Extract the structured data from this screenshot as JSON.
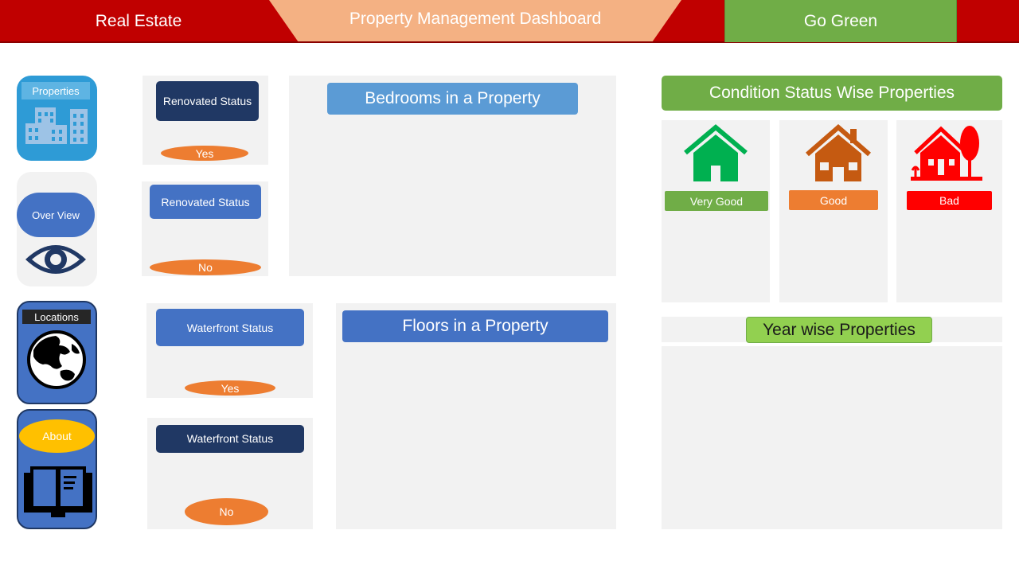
{
  "header": {
    "brand": "Real Estate",
    "title": "Property Management Dashboard",
    "go_green": "Go Green"
  },
  "nav": {
    "properties": "Properties",
    "overview": "Over View",
    "locations": "Locations",
    "about": "About"
  },
  "renovated": {
    "card1_title": "Renovated Status",
    "card1_value": "Yes",
    "card2_title": "Renovated Status",
    "card2_value": "No"
  },
  "waterfront": {
    "card1_title": "Waterfront Status",
    "card1_value": "Yes",
    "card2_title": "Waterfront Status",
    "card2_value": "No"
  },
  "charts": {
    "bedrooms_title": "Bedrooms in a Property",
    "floors_title": "Floors in a Property",
    "condition_title": "Condition Status Wise Properties",
    "year_title": "Year wise Properties"
  },
  "condition": {
    "very_good": "Very Good",
    "good": "Good",
    "bad": "Bad"
  },
  "colors": {
    "header_red": "#c00000",
    "title_peach": "#f4b183",
    "green": "#70ad47",
    "blue": "#4472c4",
    "navy": "#203864",
    "orange": "#ed7d31",
    "bad_red": "#ff0000"
  }
}
